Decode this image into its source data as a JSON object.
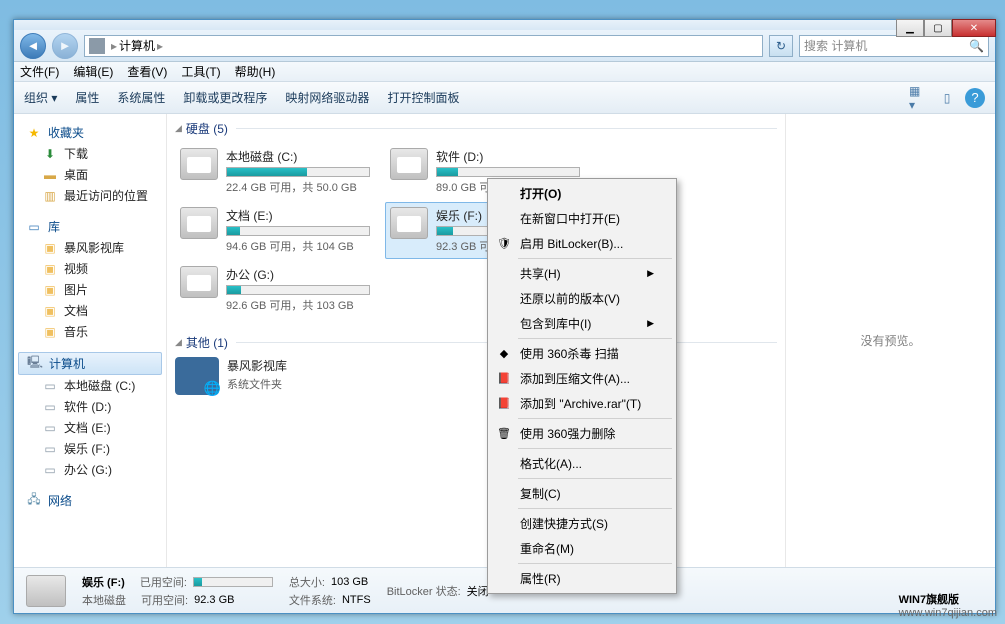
{
  "window": {
    "breadcrumb": "计算机",
    "search_placeholder": "搜索 计算机"
  },
  "menubar": [
    "文件(F)",
    "编辑(E)",
    "查看(V)",
    "工具(T)",
    "帮助(H)"
  ],
  "toolbar": {
    "organize": "组织",
    "items": [
      "属性",
      "系统属性",
      "卸载或更改程序",
      "映射网络驱动器",
      "打开控制面板"
    ]
  },
  "sidebar": {
    "favorites": {
      "label": "收藏夹",
      "items": [
        "下载",
        "桌面",
        "最近访问的位置"
      ]
    },
    "libraries": {
      "label": "库",
      "items": [
        "暴风影视库",
        "视频",
        "图片",
        "文档",
        "音乐"
      ]
    },
    "computer": {
      "label": "计算机",
      "items": [
        "本地磁盘 (C:)",
        "软件 (D:)",
        "文档 (E:)",
        "娱乐 (F:)",
        "办公 (G:)"
      ]
    },
    "network": {
      "label": "网络"
    }
  },
  "categories": {
    "disks": {
      "label": "硬盘 (5)"
    },
    "other": {
      "label": "其他 (1)"
    }
  },
  "drives": [
    {
      "name": "本地磁盘 (C:)",
      "text": "22.4 GB 可用，共 50.0 GB",
      "fill": 56
    },
    {
      "name": "软件 (D:)",
      "text": "89.0 GB 可用，共 104 GB",
      "fill": 15
    },
    {
      "name": "文档 (E:)",
      "text": "94.6 GB 可用，共 104 GB",
      "fill": 9
    },
    {
      "name": "娱乐 (F:)",
      "text": "92.3 GB 可用，共",
      "fill": 11,
      "selected": true
    },
    {
      "name": "办公 (G:)",
      "text": "92.6 GB 可用，共 103 GB",
      "fill": 10
    }
  ],
  "other_items": [
    {
      "name": "暴风影视库",
      "sub": "系统文件夹"
    }
  ],
  "preview": {
    "text": "没有预览。"
  },
  "context_menu": [
    {
      "label": "打开(O)",
      "bold": true
    },
    {
      "label": "在新窗口中打开(E)"
    },
    {
      "label": "启用 BitLocker(B)...",
      "icon": "🛡"
    },
    {
      "sep": true
    },
    {
      "label": "共享(H)",
      "sub": true
    },
    {
      "label": "还原以前的版本(V)"
    },
    {
      "label": "包含到库中(I)",
      "sub": true
    },
    {
      "sep": true
    },
    {
      "label": "使用 360杀毒 扫描",
      "icon": "◆"
    },
    {
      "label": "添加到压缩文件(A)...",
      "icon": "📕"
    },
    {
      "label": "添加到 \"Archive.rar\"(T)",
      "icon": "📕"
    },
    {
      "sep": true
    },
    {
      "label": "使用 360强力删除",
      "icon": "🗑"
    },
    {
      "sep": true
    },
    {
      "label": "格式化(A)..."
    },
    {
      "sep": true
    },
    {
      "label": "复制(C)"
    },
    {
      "sep": true
    },
    {
      "label": "创建快捷方式(S)"
    },
    {
      "label": "重命名(M)"
    },
    {
      "sep": true
    },
    {
      "label": "属性(R)"
    }
  ],
  "statusbar": {
    "name": "娱乐 (F:)",
    "used_label": "已用空间:",
    "type": "本地磁盘",
    "free_label": "可用空间:",
    "free": "92.3 GB",
    "size_label": "总大小:",
    "size": "103 GB",
    "fs_label": "文件系统:",
    "fs": "NTFS",
    "bitlocker_label": "BitLocker 状态:",
    "bitlocker": "关闭"
  },
  "watermark": {
    "title": "WIN7旗舰版",
    "url": "www.win7qijian.com"
  }
}
